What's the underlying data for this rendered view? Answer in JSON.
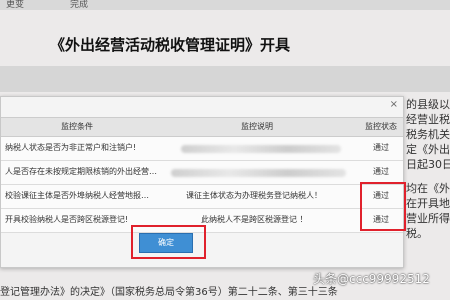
{
  "top": {
    "tab1": "更变",
    "tab2": "完成"
  },
  "page": {
    "title": "《外出经营活动税收管理证明》开具"
  },
  "right_fragments": [
    "的县级以",
    "经营业税",
    "税务机关",
    "定《外出",
    "日起30日",
    "均在《外出",
    "在开具地",
    "营业所得",
    "税。"
  ],
  "dialog": {
    "close": "×",
    "columns": [
      "监控条件",
      "监控说明",
      "监控状态"
    ],
    "rows": [
      {
        "condition": "纳税人状态是否为非正常户和注销户!",
        "description": "",
        "status": "通过"
      },
      {
        "condition": "人是否存在未按规定期限核销的外出经营…",
        "description": "",
        "status": "通过"
      },
      {
        "condition": "校验课征主体是否外埠纳税人经营地报…",
        "description": "课征主体状态为办理税务登记纳税人！",
        "status": "通过"
      },
      {
        "condition": "开具校验纳税人是否跨区税源登记!",
        "description": "此纳税人不是跨区税源登记 ！",
        "status": "通过"
      }
    ],
    "ok_label": "确定"
  },
  "bottom": {
    "line1": "",
    "line2": "登记管理办法》的决定》（国家税务总局令第36号）第二十二条、第三十三条"
  },
  "watermark": "头条@ccc99992512"
}
